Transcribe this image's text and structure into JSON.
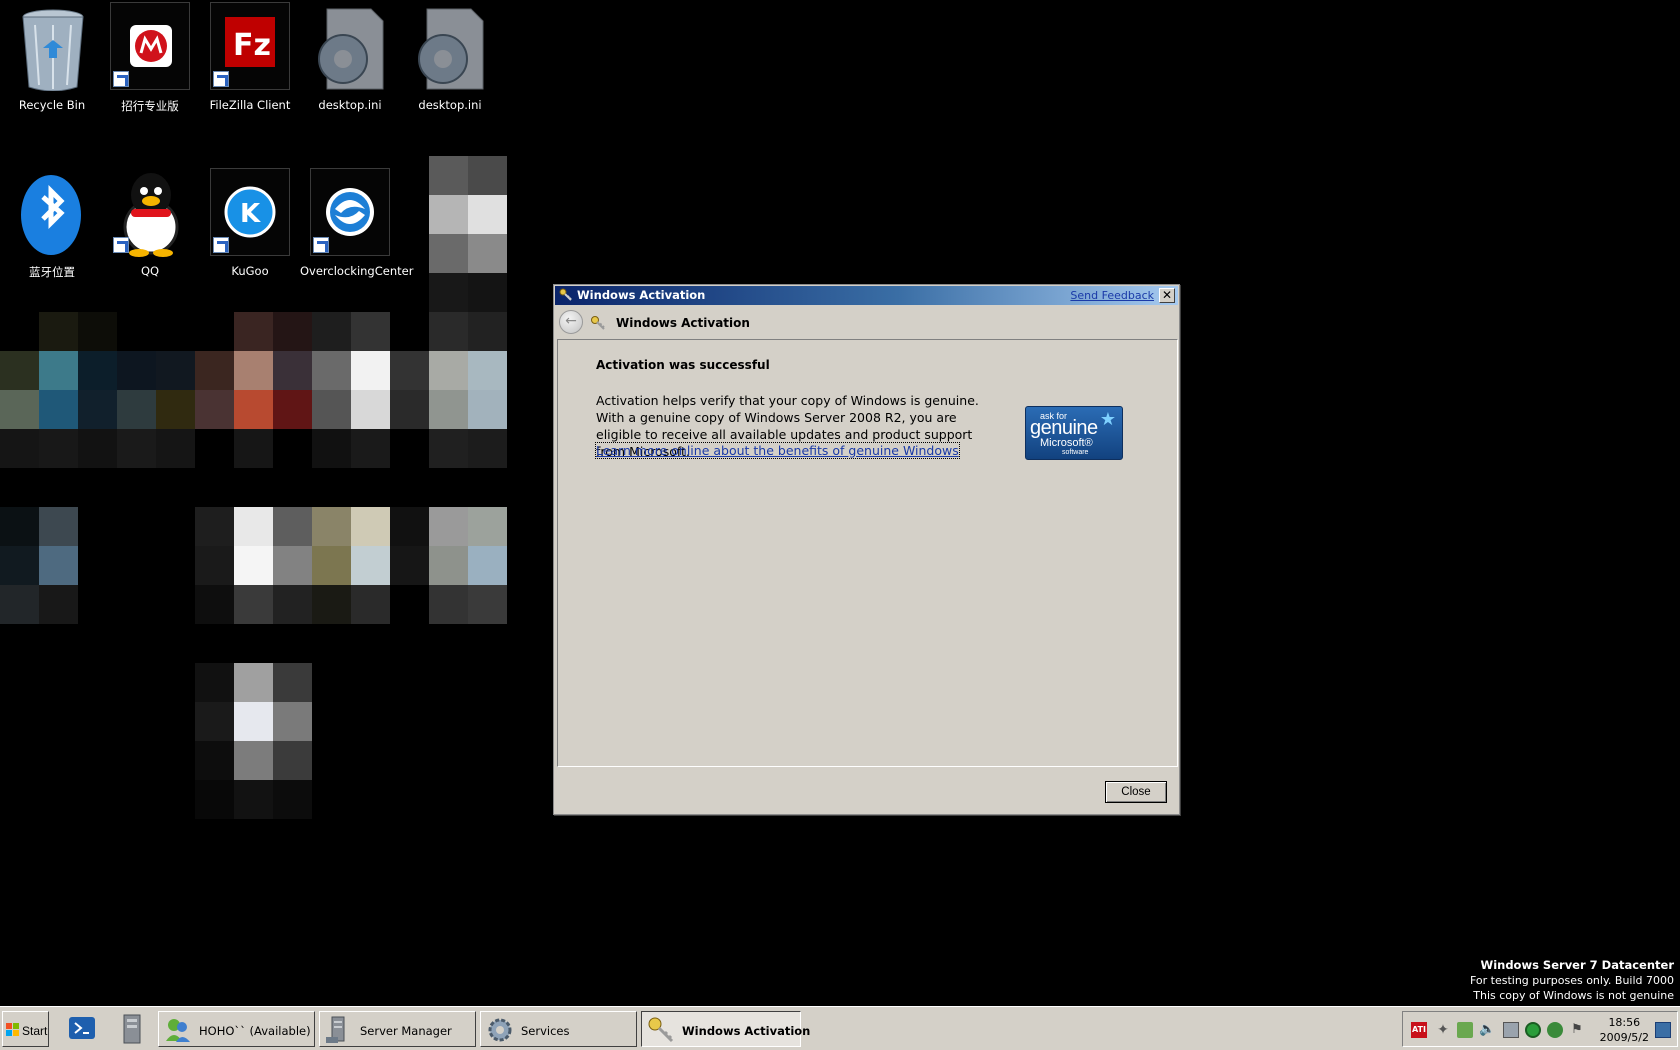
{
  "desktop": {
    "icons": [
      {
        "label": "Recycle Bin",
        "icon": "recycle-bin-icon"
      },
      {
        "label": "招行专业版",
        "icon": "cmb-bank-icon"
      },
      {
        "label": "FileZilla Client",
        "icon": "filezilla-icon"
      },
      {
        "label": "desktop.ini",
        "icon": "settings-file-icon"
      },
      {
        "label": "desktop.ini",
        "icon": "settings-file-icon"
      },
      {
        "label": "蓝牙位置",
        "icon": "bluetooth-icon"
      },
      {
        "label": "QQ",
        "icon": "qq-penguin-icon"
      },
      {
        "label": "KuGoo",
        "icon": "kugoo-icon"
      },
      {
        "label": "OverclockingCenter",
        "icon": "overclocking-icon"
      }
    ]
  },
  "dialog": {
    "title": "Windows Activation",
    "send_feedback": "Send Feedback",
    "close_x": "✕",
    "nav_title": "Windows Activation",
    "heading": "Activation was successful",
    "body": "Activation helps verify that your copy of Windows is genuine. With a genuine copy of Windows Server 2008 R2, you are eligible to receive all available updates and product support from Microsoft.",
    "link": "Learn more online about the benefits of genuine Windows",
    "badge": {
      "line1": "ask for",
      "line2": "genuine",
      "line3": "Microsoft®",
      "line4": "software"
    },
    "close_button": "Close"
  },
  "watermark": {
    "title": "Windows Server 7 Datacenter",
    "line2": "For testing purposes only. Build 7000",
    "line3": "This copy of Windows is not genuine"
  },
  "taskbar": {
    "start": "Start",
    "buttons": [
      {
        "label": "HOHO`` (Available)",
        "icon": "messenger-icon"
      },
      {
        "label": "Server Manager",
        "icon": "server-manager-icon"
      },
      {
        "label": "Services",
        "icon": "services-gear-icon"
      },
      {
        "label": "Windows Activation",
        "icon": "activation-keys-icon",
        "active": true
      }
    ],
    "clock": {
      "time": "18:56",
      "date": "2009/5/2"
    }
  },
  "colors": {
    "dialog_bg": "#d4d0c8",
    "title_gradient_start": "#0a246a",
    "title_gradient_end": "#a6caf0",
    "link": "#1a3aa8",
    "desktop": "#000000"
  }
}
